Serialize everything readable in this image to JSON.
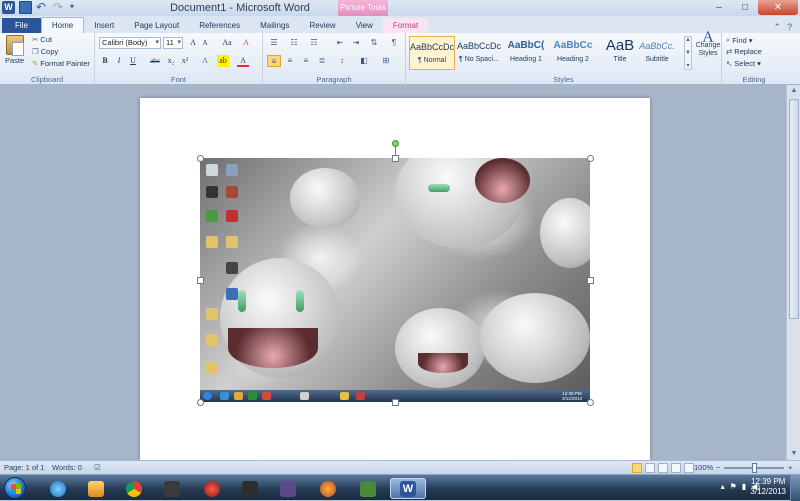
{
  "titlebar": {
    "title": "Document1 - Microsoft Word",
    "contextual_tab_header": "Picture Tools",
    "controls": [
      "–",
      "□",
      "✕"
    ]
  },
  "tabs": [
    "File",
    "Home",
    "Insert",
    "Page Layout",
    "References",
    "Mailings",
    "Review",
    "View",
    "Format"
  ],
  "ribbon": {
    "clipboard": {
      "paste": "Paste",
      "cut": "Cut",
      "copy": "Copy",
      "format_painter": "Format Painter",
      "label": "Clipboard"
    },
    "font": {
      "family": "Calibri (Body)",
      "size": "11",
      "grow": "A",
      "shrink": "A",
      "change_case": "Aa",
      "clear": "A",
      "bold": "B",
      "italic": "I",
      "underline": "U",
      "strike": "abc",
      "subscript": "x₂",
      "superscript": "x²",
      "label": "Font"
    },
    "paragraph": {
      "label": "Paragraph",
      "show_marks": "¶"
    },
    "styles": {
      "label": "Styles",
      "items": [
        {
          "sample": "AaBbCcDc",
          "name": "¶ Normal"
        },
        {
          "sample": "AaBbCcDc",
          "name": "¶ No Spaci..."
        },
        {
          "sample": "AaBbC(",
          "name": "Heading 1"
        },
        {
          "sample": "AaBbCc",
          "name": "Heading 2"
        },
        {
          "sample": "AaB",
          "name": "Title"
        },
        {
          "sample": "AaBbCc.",
          "name": "Subtitle"
        }
      ],
      "change_styles": "Change Styles"
    },
    "editing": {
      "find": "Find",
      "replace": "Replace",
      "select": "Select",
      "label": "Editing"
    }
  },
  "statusbar": {
    "page": "Page: 1 of 1",
    "words": "Words: 0",
    "zoom": "100%",
    "zoom_minus": "−",
    "zoom_plus": "+"
  },
  "taskbar": {
    "clock_time": "12:39 PM",
    "clock_date": "3/12/2013",
    "inner_clock_time": "12:38 PM",
    "inner_clock_date": "3/12/2013"
  }
}
